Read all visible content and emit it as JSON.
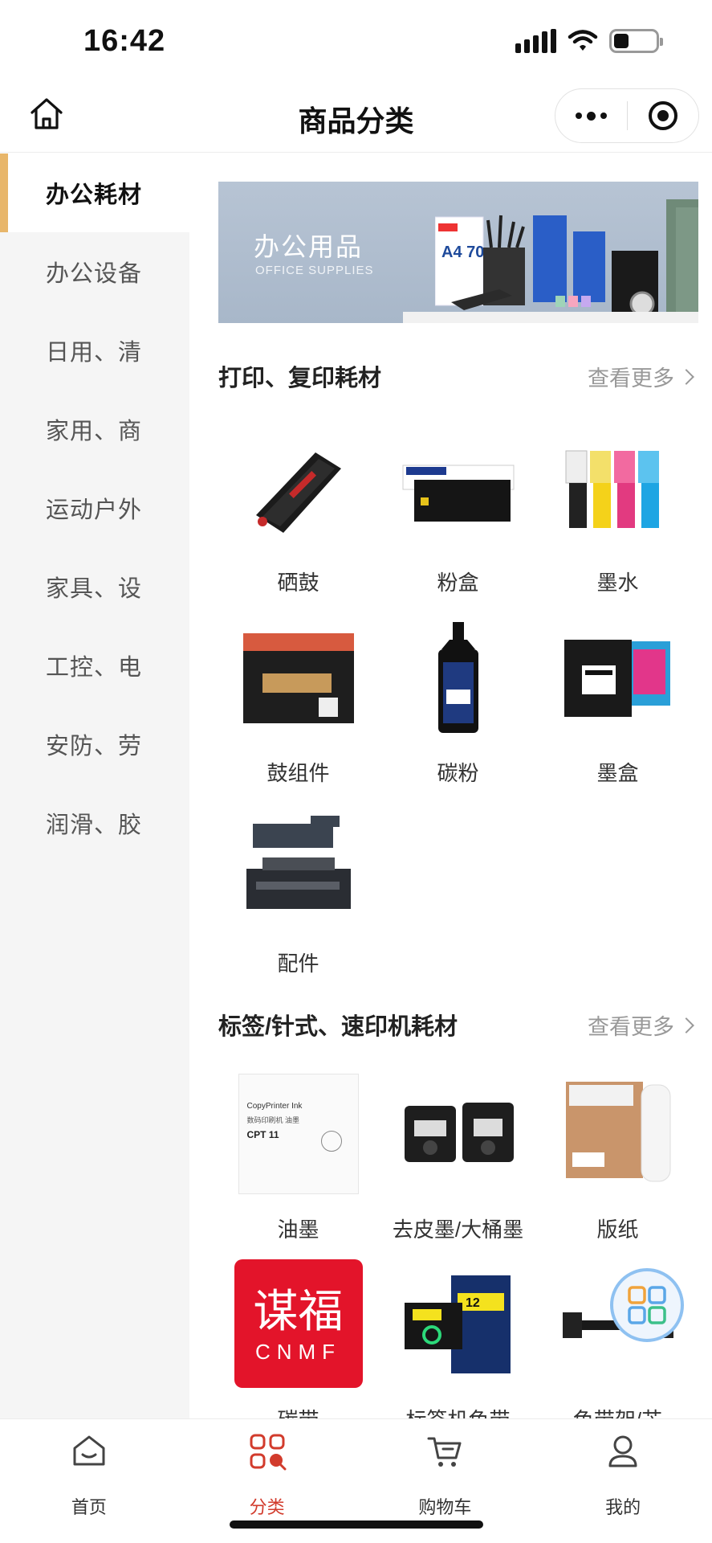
{
  "status_bar": {
    "time": "16:42",
    "battery_level": 0.35
  },
  "nav": {
    "title": "商品分类"
  },
  "sidebar": {
    "items": [
      {
        "label": "办公耗材",
        "active": true
      },
      {
        "label": "办公设备"
      },
      {
        "label": "日用、清"
      },
      {
        "label": "家用、商"
      },
      {
        "label": "运动户外"
      },
      {
        "label": "家具、设"
      },
      {
        "label": "工控、电"
      },
      {
        "label": "安防、劳"
      },
      {
        "label": "润滑、胶"
      }
    ]
  },
  "banner": {
    "title": "办公用品",
    "subtitle": "OFFICE SUPPLIES",
    "product_text": "A4 70"
  },
  "sections": [
    {
      "title": "打印、复印耗材",
      "more": "查看更多",
      "items": [
        {
          "label": "硒鼓",
          "icon": "toner-cartridge-image"
        },
        {
          "label": "粉盒",
          "icon": "toner-box-image"
        },
        {
          "label": "墨水",
          "icon": "ink-bottles-image"
        },
        {
          "label": "鼓组件",
          "icon": "drum-unit-image"
        },
        {
          "label": "碳粉",
          "icon": "toner-powder-bottle-image"
        },
        {
          "label": "墨盒",
          "icon": "ink-cartridge-image"
        },
        {
          "label": "配件",
          "icon": "printer-parts-image"
        }
      ]
    },
    {
      "title": "标签/针式、速印机耗材",
      "more": "查看更多",
      "items": [
        {
          "label": "油墨",
          "icon": "copyprinter-ink-image",
          "img_text": "CopyPrinter Ink",
          "img_text2": "数码印刷机 油墨",
          "img_text3": "CPT 11"
        },
        {
          "label": "去皮墨/大桶墨",
          "icon": "ink-drum-image"
        },
        {
          "label": "版纸",
          "icon": "master-roll-image"
        },
        {
          "label": "碳带",
          "icon": "brand-logo-image",
          "img_text": "谋福",
          "img_text2": "CNMF"
        },
        {
          "label": "标签机色带",
          "icon": "label-tape-image",
          "img_text": "12"
        },
        {
          "label": "色带架/芯",
          "icon": "ribbon-rack-image"
        }
      ]
    }
  ],
  "tab_bar": {
    "tabs": [
      {
        "label": "首页",
        "icon": "home-icon"
      },
      {
        "label": "分类",
        "icon": "category-icon",
        "active": true
      },
      {
        "label": "购物车",
        "icon": "cart-icon"
      },
      {
        "label": "我的",
        "icon": "profile-icon"
      }
    ]
  },
  "colors": {
    "accent": "#d23b2c",
    "sidebar_indicator": "#e8b66a",
    "sidebar_bg": "#f5f5f5",
    "float_btn_border": "#8ec1f1"
  }
}
